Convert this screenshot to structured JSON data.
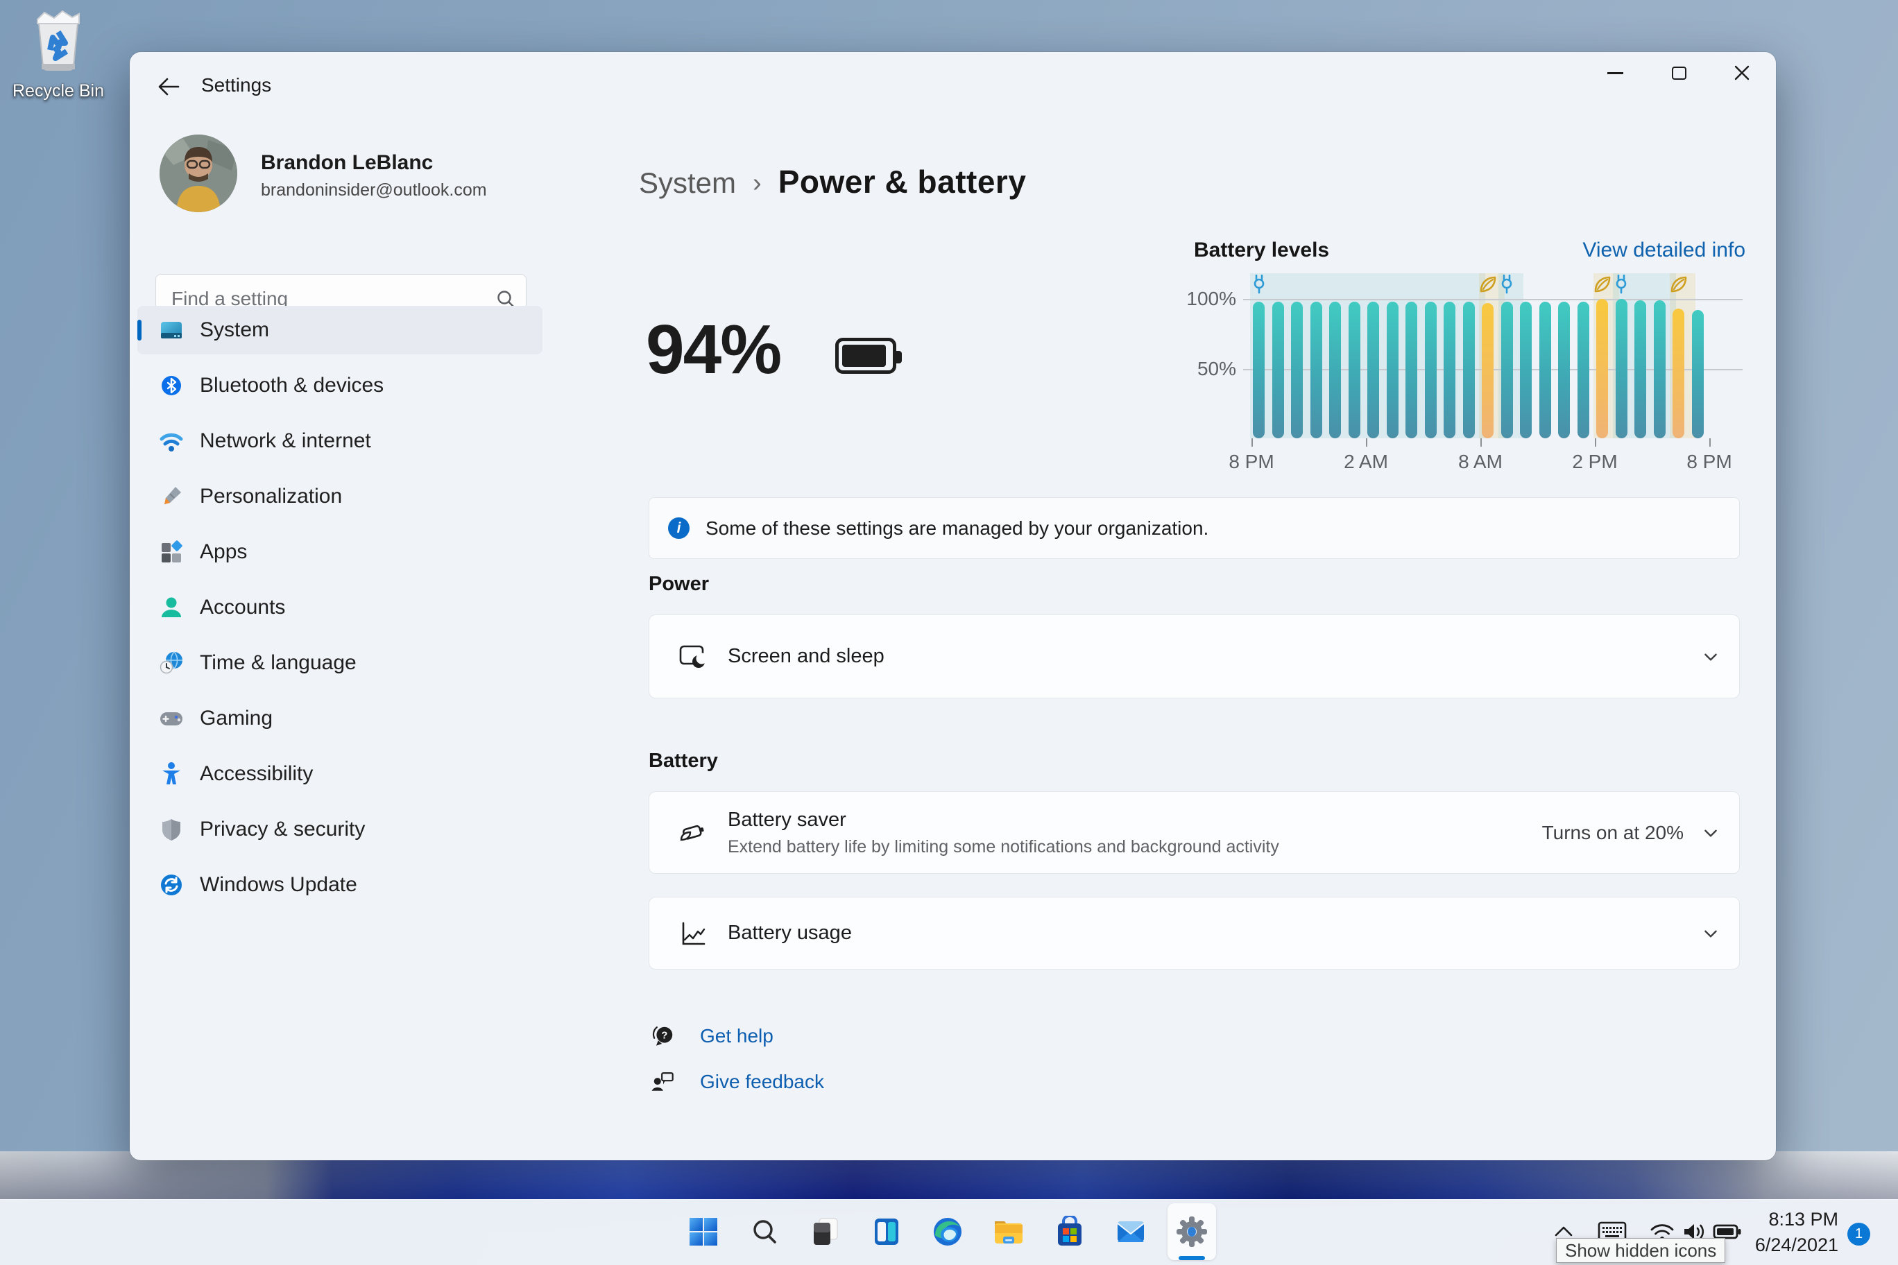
{
  "desktop": {
    "recycle_bin_label": "Recycle Bin"
  },
  "window": {
    "title": "Settings",
    "controls": [
      "minimize",
      "maximize",
      "close"
    ]
  },
  "profile": {
    "name": "Brandon LeBlanc",
    "email": "brandoninsider@outlook.com"
  },
  "search": {
    "placeholder": "Find a setting"
  },
  "sidebar": {
    "items": [
      {
        "label": "System",
        "selected": true
      },
      {
        "label": "Bluetooth & devices",
        "selected": false
      },
      {
        "label": "Network & internet",
        "selected": false
      },
      {
        "label": "Personalization",
        "selected": false
      },
      {
        "label": "Apps",
        "selected": false
      },
      {
        "label": "Accounts",
        "selected": false
      },
      {
        "label": "Time & language",
        "selected": false
      },
      {
        "label": "Gaming",
        "selected": false
      },
      {
        "label": "Accessibility",
        "selected": false
      },
      {
        "label": "Privacy & security",
        "selected": false
      },
      {
        "label": "Windows Update",
        "selected": false
      }
    ]
  },
  "breadcrumb": {
    "parent": "System",
    "separator": "›",
    "current": "Power & battery"
  },
  "battery_summary": {
    "percent": "94%"
  },
  "chart_data": {
    "type": "bar",
    "title": "Battery levels",
    "detail_link": "View detailed info",
    "ylim": [
      0,
      100
    ],
    "grid": true,
    "y_ticks": [
      {
        "label": "100%",
        "value": 100
      },
      {
        "label": "50%",
        "value": 50
      }
    ],
    "x_tick_labels": [
      "8 PM",
      "2 AM",
      "8 AM",
      "2 PM",
      "8 PM"
    ],
    "x_description": "24 hourly bars from 8 PM to 8 PM",
    "values": [
      98,
      98,
      98,
      98,
      98,
      98,
      98,
      98,
      98,
      98,
      98,
      98,
      97,
      98,
      98,
      98,
      98,
      98,
      100,
      100,
      99,
      99,
      93,
      92
    ],
    "saver_bars": [
      12,
      18,
      22
    ],
    "regions": [
      {
        "kind": "plugged-in",
        "start": 0,
        "end": 12
      },
      {
        "kind": "battery-saver",
        "start": 12,
        "end": 13
      },
      {
        "kind": "plugged-in",
        "start": 13,
        "end": 14
      },
      {
        "kind": "battery-saver",
        "start": 18,
        "end": 19
      },
      {
        "kind": "plugged-in",
        "start": 19,
        "end": 22
      },
      {
        "kind": "battery-saver",
        "start": 22,
        "end": 23
      }
    ],
    "markers": [
      {
        "icon": "plug",
        "bar": 0
      },
      {
        "icon": "leaf",
        "bar": 12
      },
      {
        "icon": "plug",
        "bar": 13
      },
      {
        "icon": "leaf",
        "bar": 18
      },
      {
        "icon": "plug",
        "bar": 19
      },
      {
        "icon": "leaf",
        "bar": 22
      }
    ],
    "colors": {
      "bar_normal": "#3fb0b8",
      "bar_saver": "#f3c050",
      "plug_icon": "#2e9bd6",
      "leaf_icon": "#cfa01f",
      "link": "#0f62ae"
    }
  },
  "banner": {
    "text": "Some of these settings are managed by your organization."
  },
  "sections": {
    "power": {
      "title": "Power",
      "cards": [
        {
          "title": "Screen and sleep"
        }
      ]
    },
    "battery": {
      "title": "Battery",
      "cards": [
        {
          "title": "Battery saver",
          "subtitle": "Extend battery life by limiting some notifications and background activity",
          "value": "Turns on at 20%"
        },
        {
          "title": "Battery usage"
        }
      ]
    }
  },
  "links": {
    "get_help": "Get help",
    "give_feedback": "Give feedback"
  },
  "taskbar": {
    "icons": [
      "start",
      "search",
      "task-view",
      "widgets",
      "edge",
      "file-explorer",
      "store",
      "mail",
      "settings"
    ],
    "active_icon": "settings",
    "tray": {
      "tooltip": "Show hidden icons",
      "time": "8:13 PM",
      "date": "6/24/2021",
      "badge": "1"
    }
  }
}
